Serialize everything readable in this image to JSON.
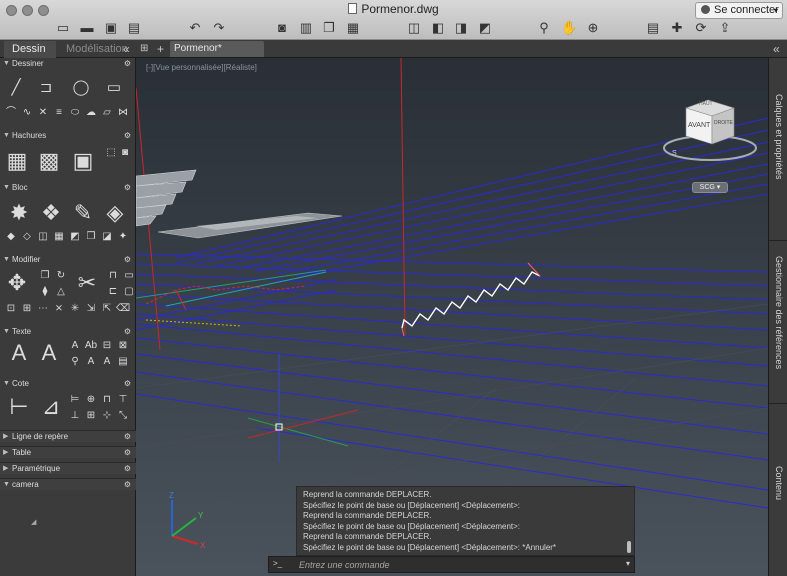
{
  "window": {
    "title": "Pormenor.dwg",
    "login_label": "Se connecter"
  },
  "palette": {
    "tabs": [
      "Dessin",
      "Modélisation"
    ],
    "collapse_glyph": "«",
    "sections": [
      {
        "name": "Dessiner",
        "expanded": true
      },
      {
        "name": "Hachures",
        "expanded": true
      },
      {
        "name": "Bloc",
        "expanded": true
      },
      {
        "name": "Modifier",
        "expanded": true
      },
      {
        "name": "Texte",
        "expanded": true
      },
      {
        "name": "Cote",
        "expanded": true
      },
      {
        "name": "Ligne de repère",
        "expanded": false
      },
      {
        "name": "Table",
        "expanded": false
      },
      {
        "name": "Paramétrique",
        "expanded": false
      },
      {
        "name": "camera",
        "expanded": true
      }
    ]
  },
  "doc_tab": {
    "label": "Pormenor*"
  },
  "viewport": {
    "label": "[-][Vue personnalisée][Réaliste]",
    "viewcube_top": "HAUT",
    "viewcube_front": "AVANT",
    "viewcube_right": "DROITE",
    "compass_south": "S",
    "ucs_label": "SCG"
  },
  "command": {
    "history": [
      "Reprend la commande DEPLACER.",
      "Spécifiez le point de base ou [Déplacement] <Déplacement>:",
      "Reprend la commande DEPLACER.",
      "Spécifiez le point de base ou [Déplacement] <Déplacement>:",
      "Reprend la commande DEPLACER.",
      "Spécifiez le point de base ou [Déplacement] <Déplacement>: *Annuler*"
    ],
    "prompt_glyph": ">_",
    "placeholder": "Entrez une commande"
  },
  "right_panel": {
    "tabs": [
      "Calques et propriétés",
      "Gestionnaire des références",
      "Contenu"
    ]
  },
  "colors": {
    "titlebar": "#c9c9c9",
    "panel": "#3b3b3b",
    "canvas_top": "#2a2f36",
    "canvas_bottom": "#4a535c",
    "grid_blue": "#2828c8",
    "axis_red": "#c82828",
    "axis_green": "#28a83c"
  }
}
